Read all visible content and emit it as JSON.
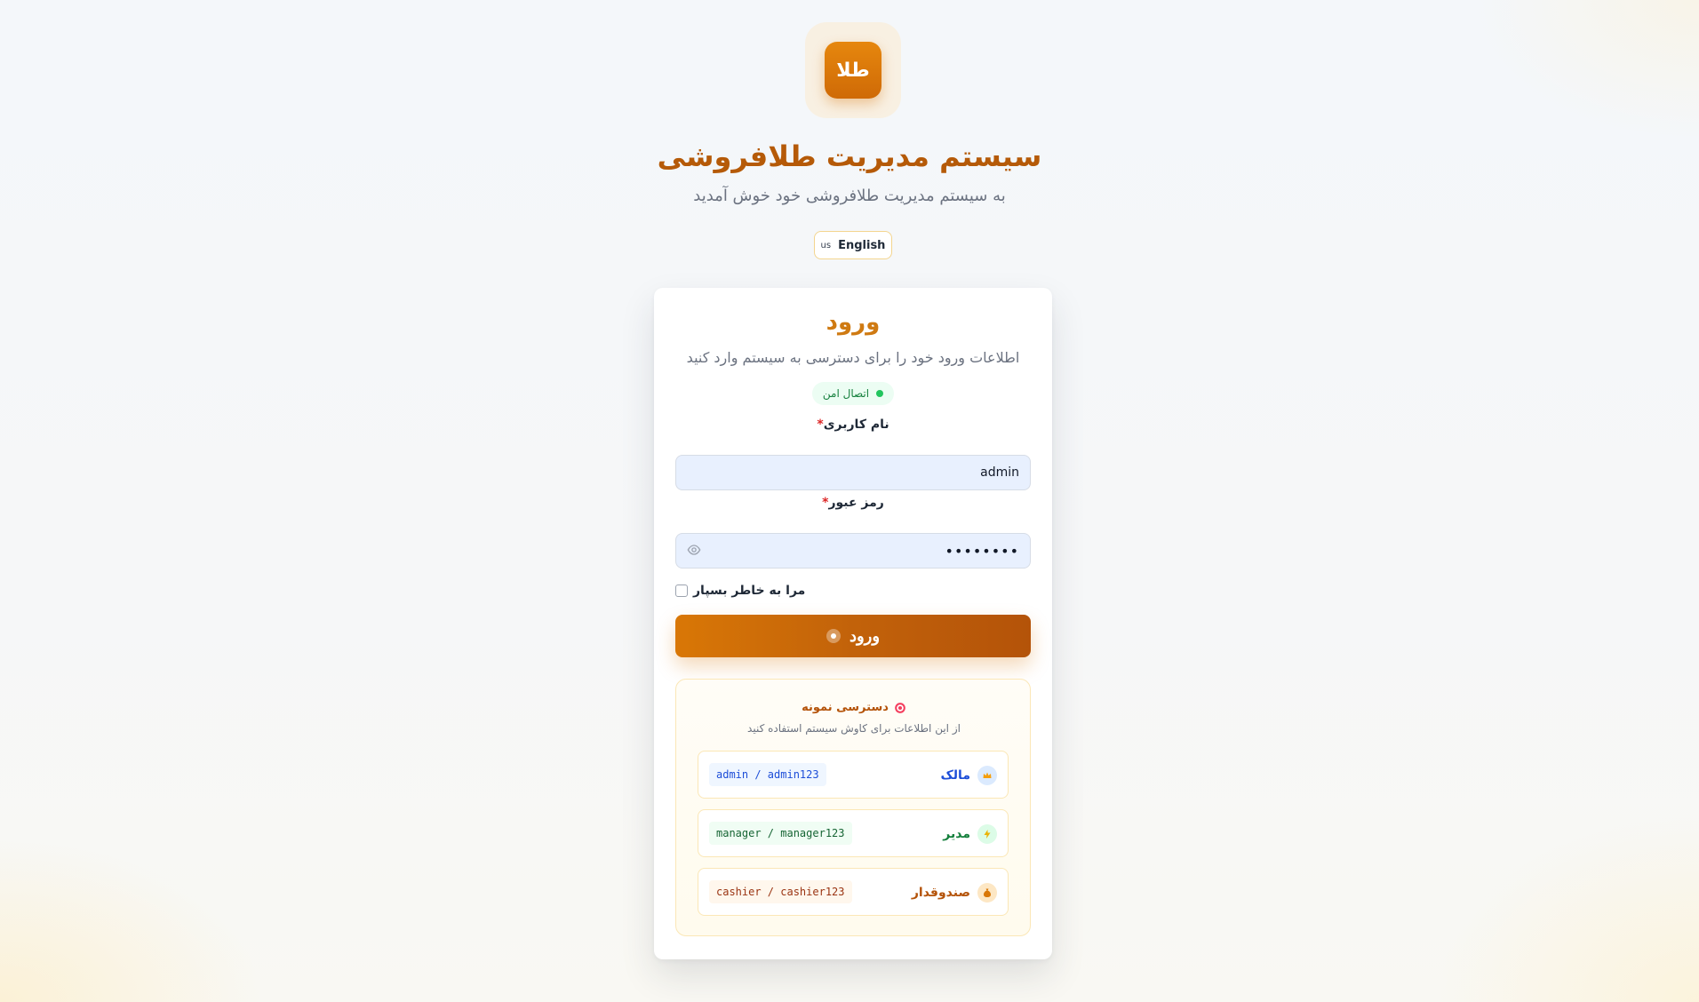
{
  "logo": {
    "text": "طلا"
  },
  "header": {
    "title": "سیستم مدیریت طلافروشی",
    "subtitle": "به سیستم مدیریت طلافروشی خود خوش آمدید"
  },
  "language": {
    "flag": "us",
    "label": "English"
  },
  "login": {
    "title": "ورود",
    "subtitle": "اطلاعات ورود خود را برای دسترسی به سیستم وارد کنید",
    "secure_badge": "اتصال امن",
    "username": {
      "label": "نام کاربری",
      "required_mark": "*",
      "value": "admin"
    },
    "password": {
      "label": "رمز عبور",
      "required_mark": "*",
      "masked_value": "••••••••"
    },
    "remember_me": "مرا به خاطر بسپار",
    "submit_label": "ورود"
  },
  "demo": {
    "title": "دسترسی نمونه",
    "subtitle": "از این اطلاعات برای کاوش سیستم استفاده کنید",
    "accounts": [
      {
        "role": "مالک",
        "credentials": "admin / admin123",
        "icon": "crown-icon",
        "color": "#1d4ed8",
        "bg": "#eff6ff",
        "icon_bg": "#dbeafe"
      },
      {
        "role": "مدیر",
        "credentials": "manager / manager123",
        "icon": "lightning-icon",
        "color": "#15803d",
        "bg": "#f0fdf4",
        "icon_bg": "#dcfce7"
      },
      {
        "role": "صندوقدار",
        "credentials": "cashier / cashier123",
        "icon": "moneybag-icon",
        "color": "#b45309",
        "bg": "#fff7ed",
        "icon_bg": "#fde7c4"
      }
    ]
  },
  "colors": {
    "accent": "#d97706",
    "title": "#b55a08",
    "secure": "#22c55e"
  }
}
